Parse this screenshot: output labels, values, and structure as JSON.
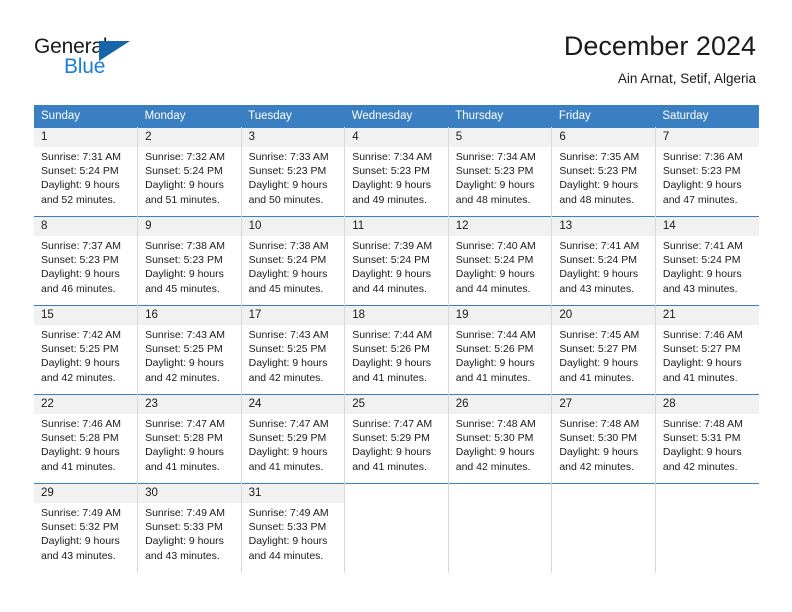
{
  "brand": {
    "name_part1": "General",
    "name_part2": "Blue",
    "triangle_color": "#1565a8",
    "blue_color": "#1a7fd4"
  },
  "header": {
    "title": "December 2024",
    "subtitle": "Ain Arnat, Setif, Algeria"
  },
  "theme": {
    "header_row_bg": "#3a7fc1",
    "header_row_text": "#ffffff",
    "daynum_band_bg": "#f1f1f1",
    "cell_bg": "#ffffff",
    "grid_line": "#d8d8d8",
    "text": "#1b1b1b"
  },
  "weekdays": [
    "Sunday",
    "Monday",
    "Tuesday",
    "Wednesday",
    "Thursday",
    "Friday",
    "Saturday"
  ],
  "weeks": [
    [
      {
        "day": "1",
        "sunrise": "Sunrise: 7:31 AM",
        "sunset": "Sunset: 5:24 PM",
        "daylight1": "Daylight: 9 hours",
        "daylight2": "and 52 minutes."
      },
      {
        "day": "2",
        "sunrise": "Sunrise: 7:32 AM",
        "sunset": "Sunset: 5:24 PM",
        "daylight1": "Daylight: 9 hours",
        "daylight2": "and 51 minutes."
      },
      {
        "day": "3",
        "sunrise": "Sunrise: 7:33 AM",
        "sunset": "Sunset: 5:23 PM",
        "daylight1": "Daylight: 9 hours",
        "daylight2": "and 50 minutes."
      },
      {
        "day": "4",
        "sunrise": "Sunrise: 7:34 AM",
        "sunset": "Sunset: 5:23 PM",
        "daylight1": "Daylight: 9 hours",
        "daylight2": "and 49 minutes."
      },
      {
        "day": "5",
        "sunrise": "Sunrise: 7:34 AM",
        "sunset": "Sunset: 5:23 PM",
        "daylight1": "Daylight: 9 hours",
        "daylight2": "and 48 minutes."
      },
      {
        "day": "6",
        "sunrise": "Sunrise: 7:35 AM",
        "sunset": "Sunset: 5:23 PM",
        "daylight1": "Daylight: 9 hours",
        "daylight2": "and 48 minutes."
      },
      {
        "day": "7",
        "sunrise": "Sunrise: 7:36 AM",
        "sunset": "Sunset: 5:23 PM",
        "daylight1": "Daylight: 9 hours",
        "daylight2": "and 47 minutes."
      }
    ],
    [
      {
        "day": "8",
        "sunrise": "Sunrise: 7:37 AM",
        "sunset": "Sunset: 5:23 PM",
        "daylight1": "Daylight: 9 hours",
        "daylight2": "and 46 minutes."
      },
      {
        "day": "9",
        "sunrise": "Sunrise: 7:38 AM",
        "sunset": "Sunset: 5:23 PM",
        "daylight1": "Daylight: 9 hours",
        "daylight2": "and 45 minutes."
      },
      {
        "day": "10",
        "sunrise": "Sunrise: 7:38 AM",
        "sunset": "Sunset: 5:24 PM",
        "daylight1": "Daylight: 9 hours",
        "daylight2": "and 45 minutes."
      },
      {
        "day": "11",
        "sunrise": "Sunrise: 7:39 AM",
        "sunset": "Sunset: 5:24 PM",
        "daylight1": "Daylight: 9 hours",
        "daylight2": "and 44 minutes."
      },
      {
        "day": "12",
        "sunrise": "Sunrise: 7:40 AM",
        "sunset": "Sunset: 5:24 PM",
        "daylight1": "Daylight: 9 hours",
        "daylight2": "and 44 minutes."
      },
      {
        "day": "13",
        "sunrise": "Sunrise: 7:41 AM",
        "sunset": "Sunset: 5:24 PM",
        "daylight1": "Daylight: 9 hours",
        "daylight2": "and 43 minutes."
      },
      {
        "day": "14",
        "sunrise": "Sunrise: 7:41 AM",
        "sunset": "Sunset: 5:24 PM",
        "daylight1": "Daylight: 9 hours",
        "daylight2": "and 43 minutes."
      }
    ],
    [
      {
        "day": "15",
        "sunrise": "Sunrise: 7:42 AM",
        "sunset": "Sunset: 5:25 PM",
        "daylight1": "Daylight: 9 hours",
        "daylight2": "and 42 minutes."
      },
      {
        "day": "16",
        "sunrise": "Sunrise: 7:43 AM",
        "sunset": "Sunset: 5:25 PM",
        "daylight1": "Daylight: 9 hours",
        "daylight2": "and 42 minutes."
      },
      {
        "day": "17",
        "sunrise": "Sunrise: 7:43 AM",
        "sunset": "Sunset: 5:25 PM",
        "daylight1": "Daylight: 9 hours",
        "daylight2": "and 42 minutes."
      },
      {
        "day": "18",
        "sunrise": "Sunrise: 7:44 AM",
        "sunset": "Sunset: 5:26 PM",
        "daylight1": "Daylight: 9 hours",
        "daylight2": "and 41 minutes."
      },
      {
        "day": "19",
        "sunrise": "Sunrise: 7:44 AM",
        "sunset": "Sunset: 5:26 PM",
        "daylight1": "Daylight: 9 hours",
        "daylight2": "and 41 minutes."
      },
      {
        "day": "20",
        "sunrise": "Sunrise: 7:45 AM",
        "sunset": "Sunset: 5:27 PM",
        "daylight1": "Daylight: 9 hours",
        "daylight2": "and 41 minutes."
      },
      {
        "day": "21",
        "sunrise": "Sunrise: 7:46 AM",
        "sunset": "Sunset: 5:27 PM",
        "daylight1": "Daylight: 9 hours",
        "daylight2": "and 41 minutes."
      }
    ],
    [
      {
        "day": "22",
        "sunrise": "Sunrise: 7:46 AM",
        "sunset": "Sunset: 5:28 PM",
        "daylight1": "Daylight: 9 hours",
        "daylight2": "and 41 minutes."
      },
      {
        "day": "23",
        "sunrise": "Sunrise: 7:47 AM",
        "sunset": "Sunset: 5:28 PM",
        "daylight1": "Daylight: 9 hours",
        "daylight2": "and 41 minutes."
      },
      {
        "day": "24",
        "sunrise": "Sunrise: 7:47 AM",
        "sunset": "Sunset: 5:29 PM",
        "daylight1": "Daylight: 9 hours",
        "daylight2": "and 41 minutes."
      },
      {
        "day": "25",
        "sunrise": "Sunrise: 7:47 AM",
        "sunset": "Sunset: 5:29 PM",
        "daylight1": "Daylight: 9 hours",
        "daylight2": "and 41 minutes."
      },
      {
        "day": "26",
        "sunrise": "Sunrise: 7:48 AM",
        "sunset": "Sunset: 5:30 PM",
        "daylight1": "Daylight: 9 hours",
        "daylight2": "and 42 minutes."
      },
      {
        "day": "27",
        "sunrise": "Sunrise: 7:48 AM",
        "sunset": "Sunset: 5:30 PM",
        "daylight1": "Daylight: 9 hours",
        "daylight2": "and 42 minutes."
      },
      {
        "day": "28",
        "sunrise": "Sunrise: 7:48 AM",
        "sunset": "Sunset: 5:31 PM",
        "daylight1": "Daylight: 9 hours",
        "daylight2": "and 42 minutes."
      }
    ],
    [
      {
        "day": "29",
        "sunrise": "Sunrise: 7:49 AM",
        "sunset": "Sunset: 5:32 PM",
        "daylight1": "Daylight: 9 hours",
        "daylight2": "and 43 minutes."
      },
      {
        "day": "30",
        "sunrise": "Sunrise: 7:49 AM",
        "sunset": "Sunset: 5:33 PM",
        "daylight1": "Daylight: 9 hours",
        "daylight2": "and 43 minutes."
      },
      {
        "day": "31",
        "sunrise": "Sunrise: 7:49 AM",
        "sunset": "Sunset: 5:33 PM",
        "daylight1": "Daylight: 9 hours",
        "daylight2": "and 44 minutes."
      },
      {
        "day": "",
        "sunrise": "",
        "sunset": "",
        "daylight1": "",
        "daylight2": ""
      },
      {
        "day": "",
        "sunrise": "",
        "sunset": "",
        "daylight1": "",
        "daylight2": ""
      },
      {
        "day": "",
        "sunrise": "",
        "sunset": "",
        "daylight1": "",
        "daylight2": ""
      },
      {
        "day": "",
        "sunrise": "",
        "sunset": "",
        "daylight1": "",
        "daylight2": ""
      }
    ]
  ]
}
